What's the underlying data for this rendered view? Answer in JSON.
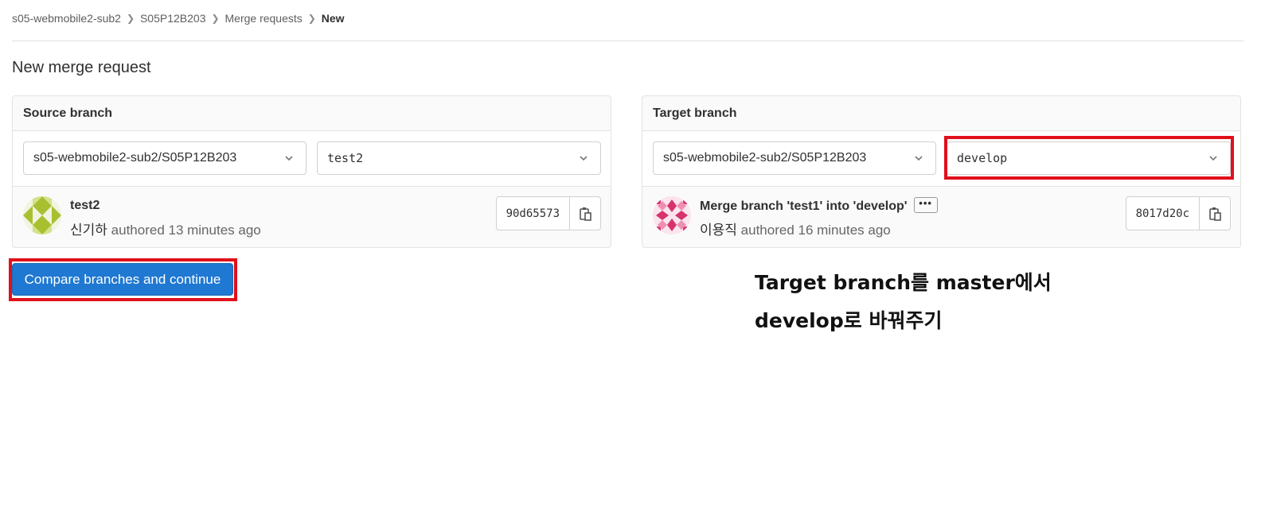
{
  "breadcrumb": [
    "s05-webmobile2-sub2",
    "S05P12B203",
    "Merge requests",
    "New"
  ],
  "page_title": "New merge request",
  "source": {
    "header": "Source branch",
    "project": "s05-webmobile2-sub2/S05P12B203",
    "branch": "test2",
    "commit": {
      "title": "test2",
      "author": "신기하",
      "meta": "authored 13 minutes ago",
      "sha": "90d65573"
    }
  },
  "target": {
    "header": "Target branch",
    "project": "s05-webmobile2-sub2/S05P12B203",
    "branch": "develop",
    "commit": {
      "title": "Merge branch 'test1' into 'develop'",
      "ellipsis": "•••",
      "author": "이용직",
      "meta": "authored 16 minutes ago",
      "sha": "8017d20c"
    }
  },
  "compare_button": "Compare branches and continue",
  "annotation": {
    "line1": "Target branch를 master에서",
    "line2": "develop로 바꿔주기"
  },
  "colors": {
    "primary": "#1f78d1",
    "highlight": "#e0101c"
  },
  "icons": {
    "breadcrumb_separator": "chevron-right-icon",
    "dropdown": "chevron-down-icon",
    "copy": "clipboard-icon"
  }
}
